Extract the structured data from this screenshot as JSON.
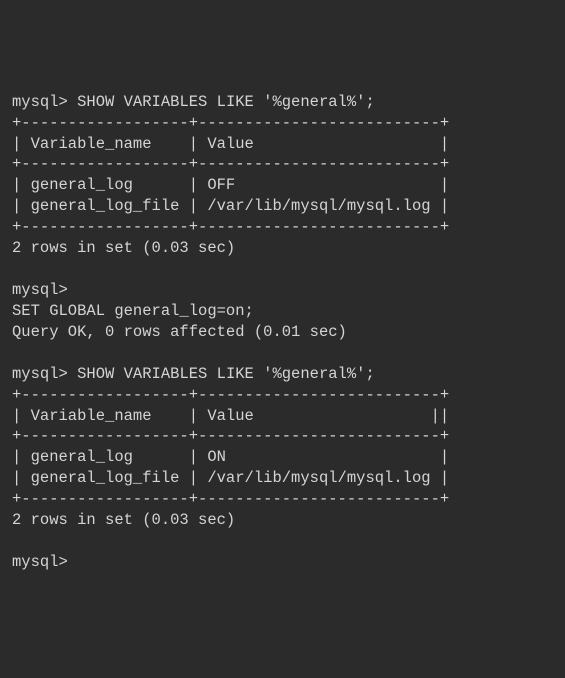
{
  "prompt": "mysql>",
  "q1": {
    "cmd": "SHOW VARIABLES LIKE '%general%';",
    "sep_top": "+------------------+--------------------------+",
    "header": "| Variable_name    | Value                    |",
    "sep_mid": "+------------------+--------------------------+",
    "row1": "| general_log      | OFF                      |",
    "row2": "| general_log_file | /var/lib/mysql/mysql.log |",
    "sep_bot": "+------------------+--------------------------+",
    "summary": "2 rows in set (0.03 sec)"
  },
  "set": {
    "cmd": "SET GLOBAL general_log=on;",
    "result": "Query OK, 0 rows affected (0.01 sec)"
  },
  "q2": {
    "cmd": "SHOW VARIABLES LIKE '%general%';",
    "sep_top": "+------------------+--------------------------+",
    "header": "| Variable_name    | Value                   ||",
    "sep_mid": "+------------------+--------------------------+",
    "row1": "| general_log      | ON                       |",
    "row2": "| general_log_file | /var/lib/mysql/mysql.log |",
    "sep_bot": "+------------------+--------------------------+",
    "summary": "2 rows in set (0.03 sec)"
  }
}
